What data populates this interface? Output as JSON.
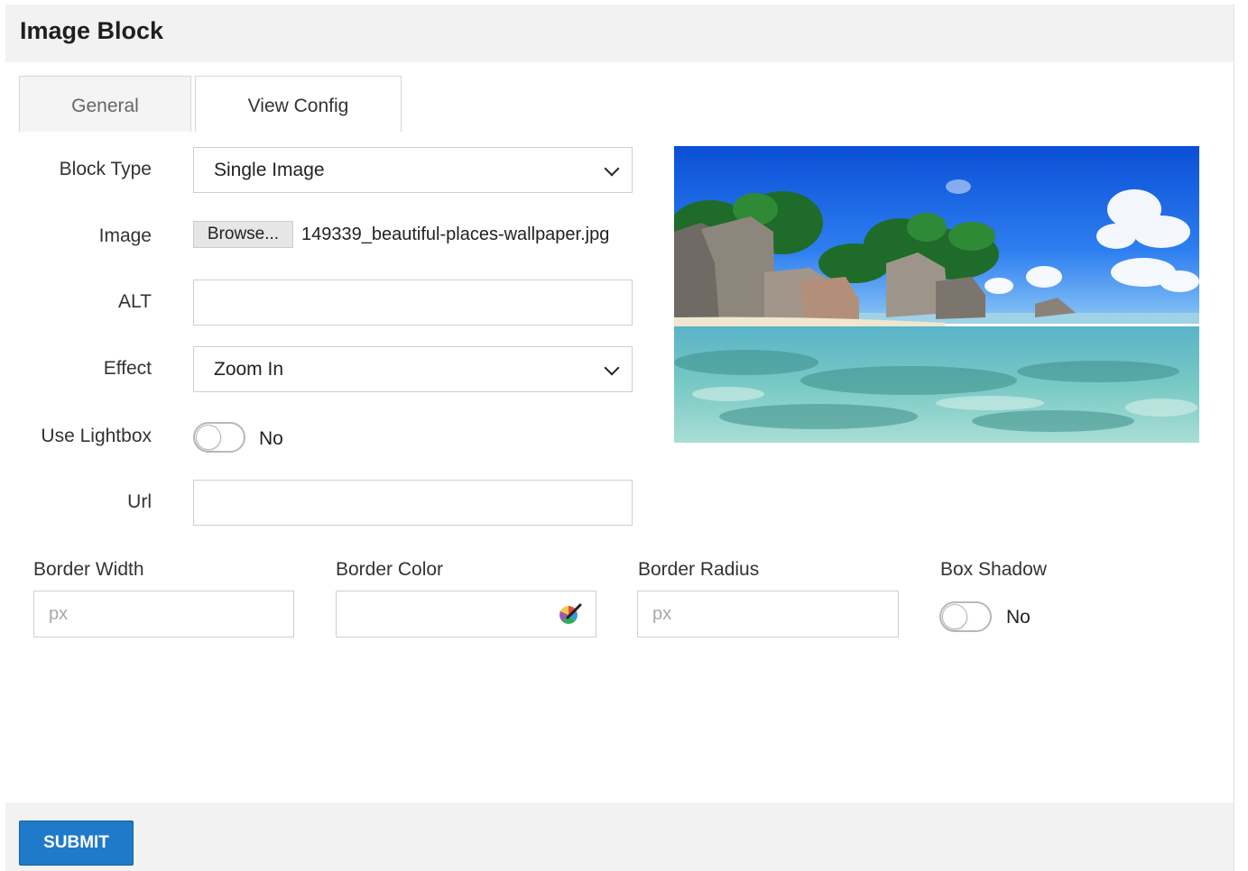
{
  "header": {
    "title": "Image Block"
  },
  "tabs": [
    {
      "label": "General"
    },
    {
      "label": "View Config"
    }
  ],
  "form": {
    "block_type": {
      "label": "Block Type",
      "value": "Single Image"
    },
    "image": {
      "label": "Image",
      "browse_label": "Browse...",
      "filename": "149339_beautiful-places-wallpaper.jpg"
    },
    "alt": {
      "label": "ALT",
      "value": ""
    },
    "effect": {
      "label": "Effect",
      "value": "Zoom In"
    },
    "use_lightbox": {
      "label": "Use Lightbox",
      "state_text": "No"
    },
    "url": {
      "label": "Url",
      "value": ""
    },
    "border_width": {
      "label": "Border Width",
      "placeholder": "px"
    },
    "border_color": {
      "label": "Border Color",
      "value": ""
    },
    "border_radius": {
      "label": "Border Radius",
      "placeholder": "px"
    },
    "box_shadow": {
      "label": "Box Shadow",
      "state_text": "No"
    }
  },
  "icons": {
    "dropdown": "chevron-down-icon",
    "color_picker": "color-picker-icon"
  },
  "colors": {
    "submit_bg": "#1f7ac9",
    "header_bg": "#f2f2f2"
  },
  "footer": {
    "submit_label": "SUBMIT"
  }
}
